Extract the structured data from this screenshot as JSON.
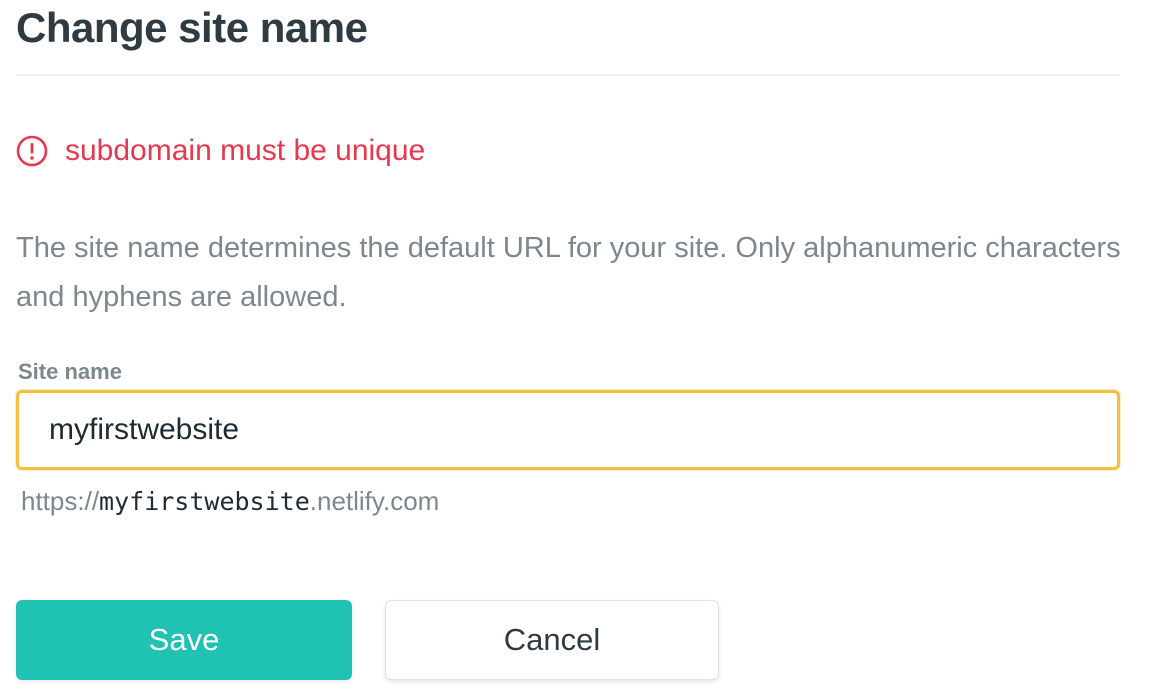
{
  "dialog": {
    "title": "Change site name",
    "error": {
      "icon": "alert-circle-icon",
      "message": "subdomain must be unique",
      "color": "#e8384f"
    },
    "description": "The site name determines the default URL for your site. Only alphanumeric characters and hyphens are allowed.",
    "field": {
      "label": "Site name",
      "value": "myfirstwebsite",
      "focus_color": "#f4bf3d"
    },
    "url_preview": {
      "prefix": "https://",
      "subdomain": "myfirstwebsite",
      "suffix": ".netlify.com"
    },
    "buttons": {
      "save_label": "Save",
      "cancel_label": "Cancel",
      "save_color": "#20c2b4"
    }
  }
}
